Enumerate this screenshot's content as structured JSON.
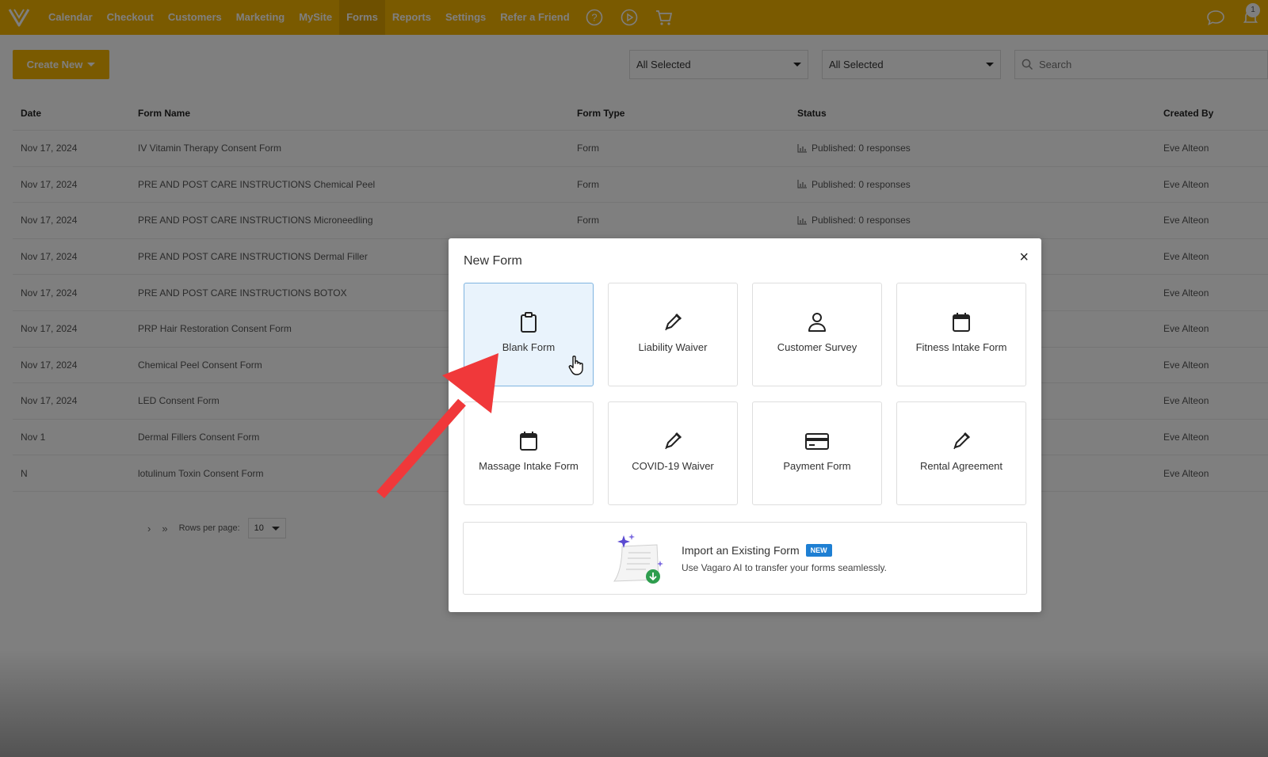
{
  "nav": {
    "items": [
      "Calendar",
      "Checkout",
      "Customers",
      "Marketing",
      "MySite",
      "Forms",
      "Reports",
      "Settings",
      "Refer a Friend"
    ],
    "active": "Forms",
    "notification_count": "1",
    "brand_color": "#f5b400"
  },
  "toolbar": {
    "create_label": "Create New",
    "filter1": "All Selected",
    "filter2": "All Selected",
    "search_placeholder": "Search"
  },
  "table": {
    "headers": {
      "date": "Date",
      "name": "Form Name",
      "type": "Form Type",
      "status": "Status",
      "created_by": "Created By"
    },
    "rows": [
      {
        "date": "Nov 17, 2024",
        "name": "IV Vitamin Therapy Consent Form",
        "type": "Form",
        "status": "Published: 0 responses",
        "created_by": "Eve Alteon"
      },
      {
        "date": "Nov 17, 2024",
        "name": "PRE AND POST CARE INSTRUCTIONS Chemical Peel",
        "type": "Form",
        "status": "Published: 0 responses",
        "created_by": "Eve Alteon"
      },
      {
        "date": "Nov 17, 2024",
        "name": "PRE AND POST CARE INSTRUCTIONS Microneedling",
        "type": "Form",
        "status": "Published: 0 responses",
        "created_by": "Eve Alteon"
      },
      {
        "date": "Nov 17, 2024",
        "name": "PRE AND POST CARE INSTRUCTIONS Dermal Filler",
        "type": "",
        "status": "",
        "created_by": "Eve Alteon"
      },
      {
        "date": "Nov 17, 2024",
        "name": "PRE AND POST CARE INSTRUCTIONS BOTOX",
        "type": "",
        "status": "",
        "created_by": "Eve Alteon"
      },
      {
        "date": "Nov 17, 2024",
        "name": "PRP Hair Restoration Consent Form",
        "type": "",
        "status": "",
        "created_by": "Eve Alteon"
      },
      {
        "date": "Nov 17, 2024",
        "name": "Chemical Peel Consent Form",
        "type": "",
        "status": "",
        "created_by": "Eve Alteon"
      },
      {
        "date": "Nov 17, 2024",
        "name": "LED Consent Form",
        "type": "",
        "status": "",
        "created_by": "Eve Alteon"
      },
      {
        "date": "Nov 1",
        "name": "Dermal Fillers Consent Form",
        "type": "",
        "status": "",
        "created_by": "Eve Alteon"
      },
      {
        "date": "N",
        "name": "lotulinum Toxin Consent Form",
        "type": "",
        "status": "",
        "created_by": "Eve Alteon"
      }
    ]
  },
  "pager": {
    "next": "›",
    "last": "»",
    "rows_per_page_label": "Rows per page:",
    "rows_per_page_value": "10"
  },
  "modal": {
    "title": "New Form",
    "close": "×",
    "cards": [
      {
        "label": "Blank Form",
        "icon": "clipboard-icon"
      },
      {
        "label": "Liability Waiver",
        "icon": "pen-icon"
      },
      {
        "label": "Customer Survey",
        "icon": "user-icon"
      },
      {
        "label": "Fitness Intake Form",
        "icon": "calendar-icon"
      },
      {
        "label": "Massage Intake Form",
        "icon": "calendar-icon"
      },
      {
        "label": "COVID-19 Waiver",
        "icon": "pen-icon"
      },
      {
        "label": "Payment Form",
        "icon": "credit-card-icon"
      },
      {
        "label": "Rental Agreement",
        "icon": "pen-icon"
      }
    ],
    "selected_card": "Blank Form",
    "import": {
      "title": "Import an Existing Form",
      "badge": "NEW",
      "subtitle": "Use Vagaro AI to transfer your forms seamlessly."
    }
  },
  "annotation": {
    "arrow_color": "#f0383a"
  }
}
